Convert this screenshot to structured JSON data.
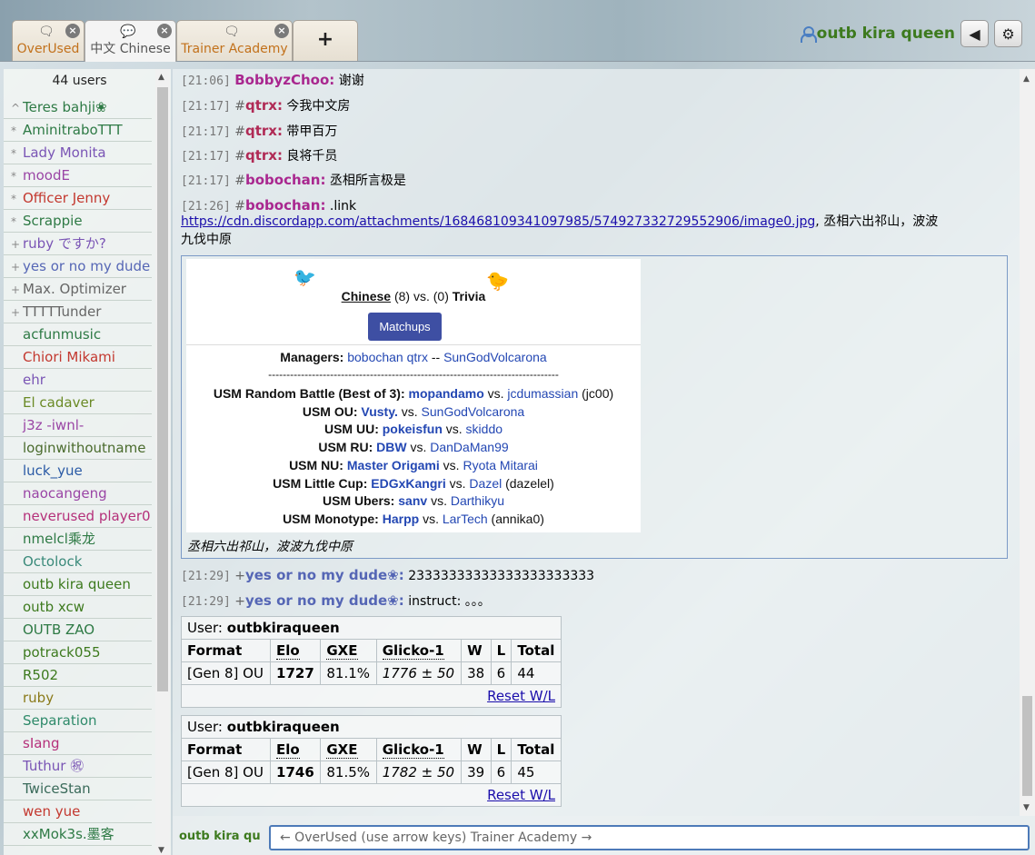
{
  "tabs": [
    {
      "label": "OverUsed",
      "active": false
    },
    {
      "label": "中文 Chinese",
      "active": true
    },
    {
      "label": "Trainer Academy",
      "active": false
    }
  ],
  "plus_label": "+",
  "user": {
    "name": "outb kira queen"
  },
  "userlist": {
    "count": "44 users",
    "users": [
      {
        "rank": "^",
        "name": "Teres bahji❀",
        "color": "#2e7a45"
      },
      {
        "rank": "*",
        "name": "AminitraboTTT",
        "color": "#2e7a45"
      },
      {
        "rank": "*",
        "name": "Lady Monita",
        "color": "#7a55b5"
      },
      {
        "rank": "*",
        "name": "moodE",
        "color": "#9a45a5"
      },
      {
        "rank": "*",
        "name": "Officer Jenny",
        "color": "#c3382f"
      },
      {
        "rank": "*",
        "name": "Scrappie",
        "color": "#2e7a45"
      },
      {
        "rank": "+",
        "name": "ruby ですか?",
        "color": "#7a55b5"
      },
      {
        "rank": "+",
        "name": "yes or no my dude",
        "color": "#5566b5"
      },
      {
        "rank": "+",
        "name": "Max. Optimizer",
        "color": "#666"
      },
      {
        "rank": "+",
        "name": "TTTTTunder",
        "color": "#666"
      },
      {
        "rank": "",
        "name": "acfunmusic",
        "color": "#2e7a45"
      },
      {
        "rank": "",
        "name": "Chiori Mikami",
        "color": "#c3382f"
      },
      {
        "rank": "",
        "name": "ehr",
        "color": "#7a55b5"
      },
      {
        "rank": "",
        "name": "El cadaver",
        "color": "#6a8a25"
      },
      {
        "rank": "",
        "name": "j3z -iwnl-",
        "color": "#9a45a5"
      },
      {
        "rank": "",
        "name": "loginwithoutname",
        "color": "#4a6b2d"
      },
      {
        "rank": "",
        "name": "luck_yue",
        "color": "#2a5aa5"
      },
      {
        "rank": "",
        "name": "naocangeng",
        "color": "#9a45a5"
      },
      {
        "rank": "",
        "name": "neverused player0",
        "color": "#b5307a"
      },
      {
        "rank": "",
        "name": "nmelcl乘龙",
        "color": "#2e7a45"
      },
      {
        "rank": "",
        "name": "Octolock",
        "color": "#3a8a7a"
      },
      {
        "rank": "",
        "name": "outb kira queen",
        "color": "#3d7a1e"
      },
      {
        "rank": "",
        "name": "outb xcw",
        "color": "#3d7a1e"
      },
      {
        "rank": "",
        "name": "OUTB ZAO",
        "color": "#2e7a45"
      },
      {
        "rank": "",
        "name": "potrack055",
        "color": "#3d7a1e"
      },
      {
        "rank": "",
        "name": "R502",
        "color": "#3d7a1e"
      },
      {
        "rank": "",
        "name": "ruby",
        "color": "#8a7a1a"
      },
      {
        "rank": "",
        "name": "Separation",
        "color": "#2e8a6a"
      },
      {
        "rank": "",
        "name": "sIang",
        "color": "#b5307a"
      },
      {
        "rank": "",
        "name": "Tuthur ㊗",
        "color": "#7a55b5"
      },
      {
        "rank": "",
        "name": "TwiceStan",
        "color": "#3a6a5a"
      },
      {
        "rank": "",
        "name": "wen yue",
        "color": "#c3382f"
      },
      {
        "rank": "",
        "name": "xxMok3s.墨客",
        "color": "#2e7a45"
      }
    ]
  },
  "chat": {
    "messages": [
      {
        "time": "[21:06]",
        "rank": "",
        "user": "BobbyzChoo:",
        "text": "谢谢",
        "color": "#a9278f"
      },
      {
        "time": "[21:17]",
        "rank": "#",
        "user": "qtrx:",
        "text": "今我中文房",
        "color": "#b02a55"
      },
      {
        "time": "[21:17]",
        "rank": "#",
        "user": "qtrx:",
        "text": "带甲百万",
        "color": "#b02a55"
      },
      {
        "time": "[21:17]",
        "rank": "#",
        "user": "qtrx:",
        "text": "良将千员",
        "color": "#b02a55"
      },
      {
        "time": "[21:17]",
        "rank": "#",
        "user": "bobochan:",
        "text": "丞相所言极是",
        "color": "#a9278f"
      },
      {
        "time": "[21:26]",
        "rank": "#",
        "user": "bobochan:",
        "text": ".link",
        "color": "#a9278f"
      }
    ],
    "link_url": "https://cdn.discordapp.com/attachments/168468109341097985/574927332729552906/image0.jpg",
    "link_tail": ", 丞相六出祁山，波波",
    "link_tail2": "九伐中原",
    "image": {
      "team_left": "Chinese",
      "score": "(8) vs. (0)",
      "team_right": "Trivia",
      "matchups_btn": "Matchups",
      "managers_label": "Managers:",
      "managers_left": "bobochan qtrx",
      "managers_sep": "--",
      "managers_right": "SunGodVolcarona",
      "divider": "--------------------------------------------------------------------------------",
      "lines": [
        {
          "fmt": "USM Random Battle (Best of 3):",
          "p1": "mopandamo",
          "vs": "vs.",
          "p2": "jcdumassian",
          "note": "(jc00)"
        },
        {
          "fmt": "USM OU:",
          "p1": "Vusty.",
          "vs": "vs.",
          "p2": "SunGodVolcarona",
          "note": ""
        },
        {
          "fmt": "USM UU:",
          "p1": "pokeisfun",
          "vs": "vs.",
          "p2": "skiddo",
          "note": ""
        },
        {
          "fmt": "USM RU:",
          "p1": "DBW",
          "vs": "vs.",
          "p2": "DanDaMan99",
          "note": ""
        },
        {
          "fmt": "USM NU:",
          "p1": "Master Origami",
          "vs": "vs.",
          "p2": "Ryota Mitarai",
          "note": ""
        },
        {
          "fmt": "USM Little Cup:",
          "p1": "EDGxKangri",
          "vs": "vs.",
          "p2": "Dazel",
          "note": "(dazelel)"
        },
        {
          "fmt": "USM Ubers:",
          "p1": "sanv",
          "vs": "vs.",
          "p2": "Darthikyu",
          "note": ""
        },
        {
          "fmt": "USM Monotype:",
          "p1": "Harpp",
          "vs": "vs.",
          "p2": "LarTech",
          "note": "(annika0)"
        }
      ],
      "caption": "丞相六出祁山，波波九伐中原"
    },
    "late_messages": [
      {
        "time": "[21:29]",
        "rank": "+",
        "user": "yes or no my dude❀:",
        "text": "23333333333333333333333",
        "color": "#5566b5"
      },
      {
        "time": "[21:29]",
        "rank": "+",
        "user": "yes or no my dude❀:",
        "text": "instruct: 。。。",
        "color": "#5566b5"
      }
    ],
    "rating_tables": [
      {
        "user_label": "User:",
        "user": "outbkiraqueen",
        "headers": [
          "Format",
          "Elo",
          "GXE",
          "Glicko-1",
          "W",
          "L",
          "Total"
        ],
        "row": {
          "format": "[Gen 8] OU",
          "elo": "1727",
          "gxe": "81.1%",
          "glicko": "1776 ± 50",
          "w": "38",
          "l": "6",
          "total": "44"
        },
        "reset": "Reset W/L"
      },
      {
        "user_label": "User:",
        "user": "outbkiraqueen",
        "headers": [
          "Format",
          "Elo",
          "GXE",
          "Glicko-1",
          "W",
          "L",
          "Total"
        ],
        "row": {
          "format": "[Gen 8] OU",
          "elo": "1746",
          "gxe": "81.5%",
          "glicko": "1782 ± 50",
          "w": "39",
          "l": "6",
          "total": "45"
        },
        "reset": "Reset W/L"
      }
    ]
  },
  "composer": {
    "name": "outb kira qu",
    "placeholder": "← OverUsed (use arrow keys) Trainer Academy →"
  }
}
